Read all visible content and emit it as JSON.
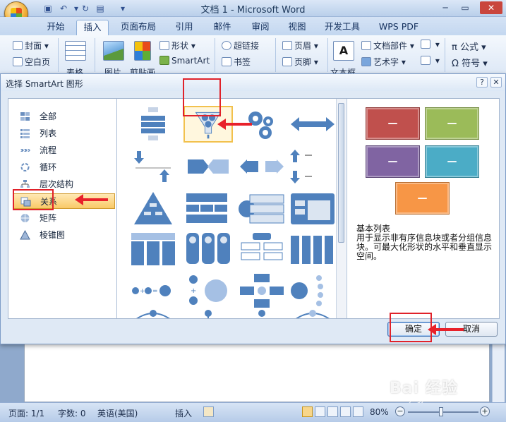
{
  "window": {
    "title": "文档 1 - Microsoft Word"
  },
  "ribbon_tabs": [
    {
      "label": "开始"
    },
    {
      "label": "插入"
    },
    {
      "label": "页面布局"
    },
    {
      "label": "引用"
    },
    {
      "label": "邮件"
    },
    {
      "label": "审阅"
    },
    {
      "label": "视图"
    },
    {
      "label": "开发工具"
    },
    {
      "label": "WPS PDF"
    }
  ],
  "ribbon": {
    "cover_page": "封面",
    "blank_page": "空白页",
    "table": "表格",
    "picture": "图片",
    "clip_art": "剪贴画",
    "shapes": "形状",
    "smartart": "SmartArt",
    "hyperlink": "超链接",
    "bookmark": "书签",
    "header": "页眉",
    "footer": "页脚",
    "text_box": "文本框",
    "quick_parts": "文档部件",
    "wordart": "艺术字",
    "equation": "公式",
    "symbol": "符号"
  },
  "dialog": {
    "title": "选择 SmartArt 图形",
    "categories": [
      {
        "label": "全部",
        "icon": "all-layouts-icon"
      },
      {
        "label": "列表",
        "icon": "list-layout-icon"
      },
      {
        "label": "流程",
        "icon": "process-layout-icon"
      },
      {
        "label": "循环",
        "icon": "cycle-layout-icon"
      },
      {
        "label": "层次结构",
        "icon": "hierarchy-layout-icon"
      },
      {
        "label": "关系",
        "icon": "relationship-layout-icon"
      },
      {
        "label": "矩阵",
        "icon": "matrix-layout-icon"
      },
      {
        "label": "棱锥图",
        "icon": "pyramid-layout-icon"
      }
    ],
    "selected_category": "关系",
    "preview_title": "基本列表",
    "preview_description": "用于显示非有序信息块或者分组信息块。可最大化形状的水平和垂直显示空间。",
    "preview_box_text": "—",
    "preview_colors": [
      "#c0504d",
      "#9bbb59",
      "#8064a2",
      "#4bacc6",
      "#f79646"
    ],
    "ok_label": "确定",
    "cancel_label": "取消"
  },
  "statusbar": {
    "page": "页面: 1/1",
    "words": "字数: 0",
    "language": "英语(美国)",
    "insert_mode": "插入",
    "zoom": "80%"
  },
  "watermark": {
    "text": "Bai 经验",
    "sub": "jingyan.baidu.com"
  }
}
